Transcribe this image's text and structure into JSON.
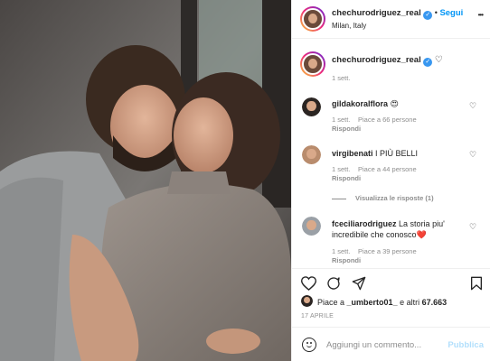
{
  "post": {
    "author": {
      "username": "chechurodriguez_real",
      "location": "Milan, Italy",
      "follow_label": "Segui",
      "verified_mark": "✓"
    },
    "more_label": "•••",
    "caption": {
      "username": "chechurodriguez_real",
      "time": "1 sett."
    },
    "comments": [
      {
        "username": "gildakoralflora",
        "text": "😍",
        "time": "1 sett.",
        "likes": "Piace a 66 persone",
        "reply": "Rispondi"
      },
      {
        "username": "virgibenati",
        "text": "I PIÙ BELLI",
        "time": "1 sett.",
        "likes": "Piace a 44 persone",
        "reply": "Rispondi",
        "view_replies": "Visualizza le risposte (1)"
      },
      {
        "username": "fceciliarodriguez",
        "text_line1": "La storia piu'",
        "text_line2": "incredibile che conosco",
        "text_emoji": "❤️",
        "time": "1 sett.",
        "likes": "Piace a 39 persone",
        "reply": "Rispondi"
      }
    ],
    "likes": {
      "prefix": "Piace a",
      "user": "_umberto01_",
      "suffix": "e altri",
      "count": "67.663"
    },
    "date": "17 APRILE",
    "add_comment": {
      "placeholder": "Aggiungi un commento...",
      "publish_label": "Pubblica"
    },
    "icons": {
      "like": "heart-icon",
      "comment": "comment-icon",
      "share": "send-icon",
      "save": "bookmark-icon",
      "emoji": "emoji-icon",
      "verified": "verified-badge-icon"
    },
    "colors": {
      "link_blue": "#0095f6",
      "verified": "#3897f0",
      "heart_red": "#ed4956"
    }
  }
}
